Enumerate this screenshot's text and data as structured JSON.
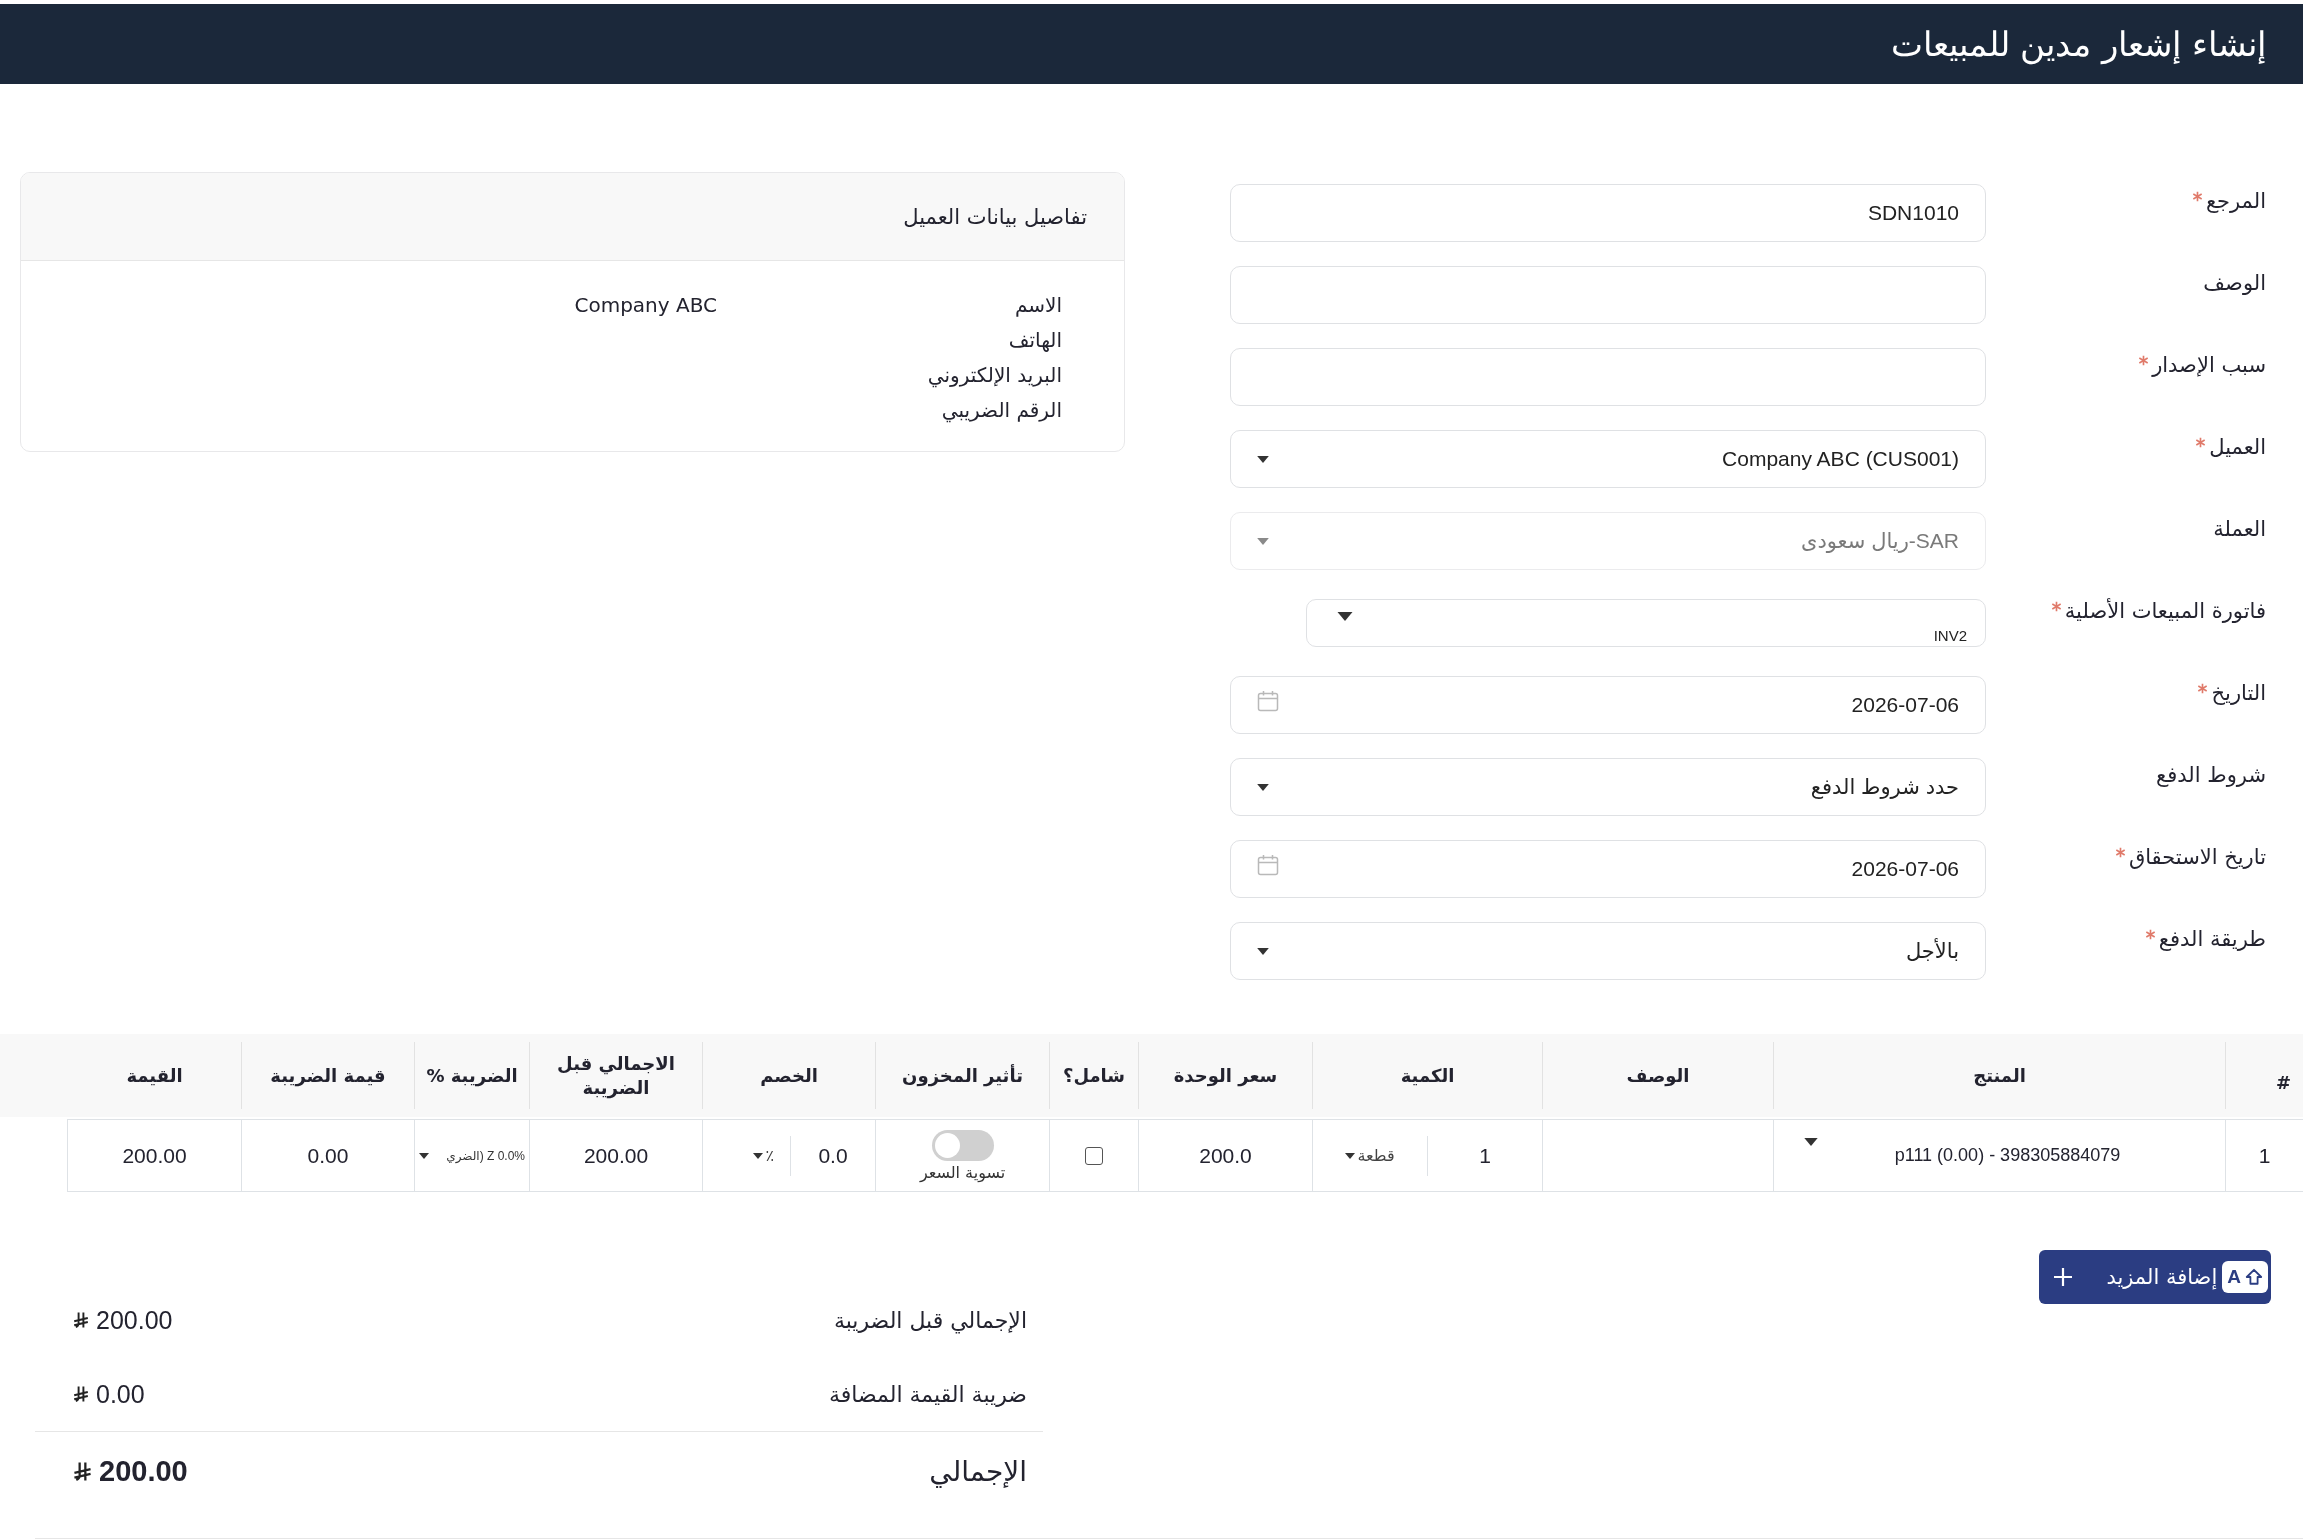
{
  "header": {
    "title": "إنشاء إشعار مدين للمبيعات"
  },
  "form": {
    "fields": [
      {
        "label": "المرجع",
        "required": true,
        "kind": "text",
        "value": "SDN1010",
        "disabled": false
      },
      {
        "label": "الوصف",
        "required": false,
        "kind": "text",
        "disabled": false
      },
      {
        "label": "سبب الإصدار",
        "required": true,
        "kind": "text",
        "disabled": false
      },
      {
        "label": "العميل",
        "required": true,
        "kind": "select",
        "value": "Company ABC (CUS001)",
        "disabled": false
      },
      {
        "label": "العملة",
        "required": false,
        "kind": "select",
        "value": "SAR-ريال سعودى",
        "disabled": true
      },
      {
        "label": "فاتورة المبيعات الأصلية",
        "required": true,
        "kind": "compact-select",
        "value": "INV2",
        "disabled": false
      },
      {
        "label": "التاريخ",
        "required": true,
        "kind": "date",
        "value": "2026-07-06",
        "disabled": false
      },
      {
        "label": "شروط الدفع",
        "required": false,
        "kind": "select",
        "value": "حدد شروط الدفع",
        "disabled": false
      },
      {
        "label": "تاريخ الاستحقاق",
        "required": true,
        "kind": "date",
        "value": "2026-07-06",
        "disabled": false
      },
      {
        "label": "طريقة الدفع",
        "required": true,
        "kind": "select",
        "value": "بالأجل",
        "disabled": false
      }
    ]
  },
  "customer_details": {
    "title": "تفاصيل بيانات العميل",
    "rows": [
      {
        "label": "الاسم",
        "value": "Company ABC"
      },
      {
        "label": "الهاتف"
      },
      {
        "label": "البريد الإلكتروني"
      },
      {
        "label": "الرقم الضريبي"
      }
    ]
  },
  "items_table": {
    "columns": [
      "#",
      "المنتج",
      "الوصف",
      "الكمية",
      "سعر الوحدة",
      "شامل؟",
      "تأثير المخزون",
      "الخصم",
      "الاجمالي قبل الضريبة",
      "الضريبة %",
      "قيمة الضريبة",
      "القيمة"
    ],
    "rows": [
      {
        "cells": [
          {
            "kind": "text",
            "text": "1"
          },
          {
            "kind": "product",
            "text": "p111 (0.00) - 398305884079"
          },
          {
            "kind": "text"
          },
          {
            "kind": "quantity",
            "text": "1",
            "unit": "قطعة"
          },
          {
            "kind": "text",
            "text": "200.0"
          },
          {
            "kind": "checkbox",
            "checked": false
          },
          {
            "kind": "toggle",
            "on": false,
            "label": "تسوية السعر"
          },
          {
            "kind": "discount",
            "text": "0.0",
            "unit": "٪"
          },
          {
            "kind": "text",
            "text": "200.00"
          },
          {
            "kind": "select",
            "text": "Z 0.0% (الضري"
          },
          {
            "kind": "text",
            "text": "0.00"
          },
          {
            "kind": "text",
            "text": "200.00"
          }
        ]
      }
    ]
  },
  "add_button": {
    "label": "إضافة المزيد",
    "shortcut": "A"
  },
  "totals": {
    "rows": [
      {
        "kind": "subtotal",
        "label": "الإجمالي قبل الضريبة",
        "amount": "200.00"
      },
      {
        "kind": "subtotal",
        "label": "ضريبة القيمة المضافة",
        "amount": "0.00"
      },
      {
        "kind": "grand",
        "label": "الإجمالي",
        "amount": "200.00"
      }
    ]
  }
}
